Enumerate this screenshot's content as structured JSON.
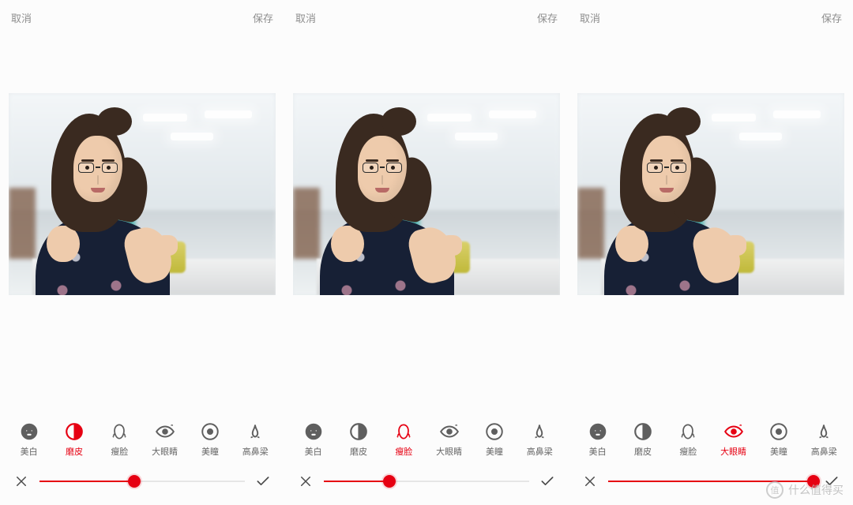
{
  "header": {
    "cancel": "取消",
    "save": "保存"
  },
  "tools": [
    {
      "id": "whiten",
      "label": "美白",
      "icon": "face-mask-icon"
    },
    {
      "id": "smooth",
      "label": "磨皮",
      "icon": "contrast-icon"
    },
    {
      "id": "slim",
      "label": "瘦脸",
      "icon": "slim-face-icon"
    },
    {
      "id": "eye",
      "label": "大眼睛",
      "icon": "eye-icon"
    },
    {
      "id": "pupil",
      "label": "美瞳",
      "icon": "iris-icon"
    },
    {
      "id": "nose",
      "label": "高鼻梁",
      "icon": "nose-icon"
    }
  ],
  "panels": [
    {
      "active_tool": 1,
      "slider_pct": 46
    },
    {
      "active_tool": 2,
      "slider_pct": 32
    },
    {
      "active_tool": 3,
      "slider_pct": 100
    }
  ],
  "watermark": {
    "badge": "值",
    "text": "什么值得买"
  },
  "colors": {
    "accent": "#e60012",
    "muted": "#8e8e8e"
  }
}
